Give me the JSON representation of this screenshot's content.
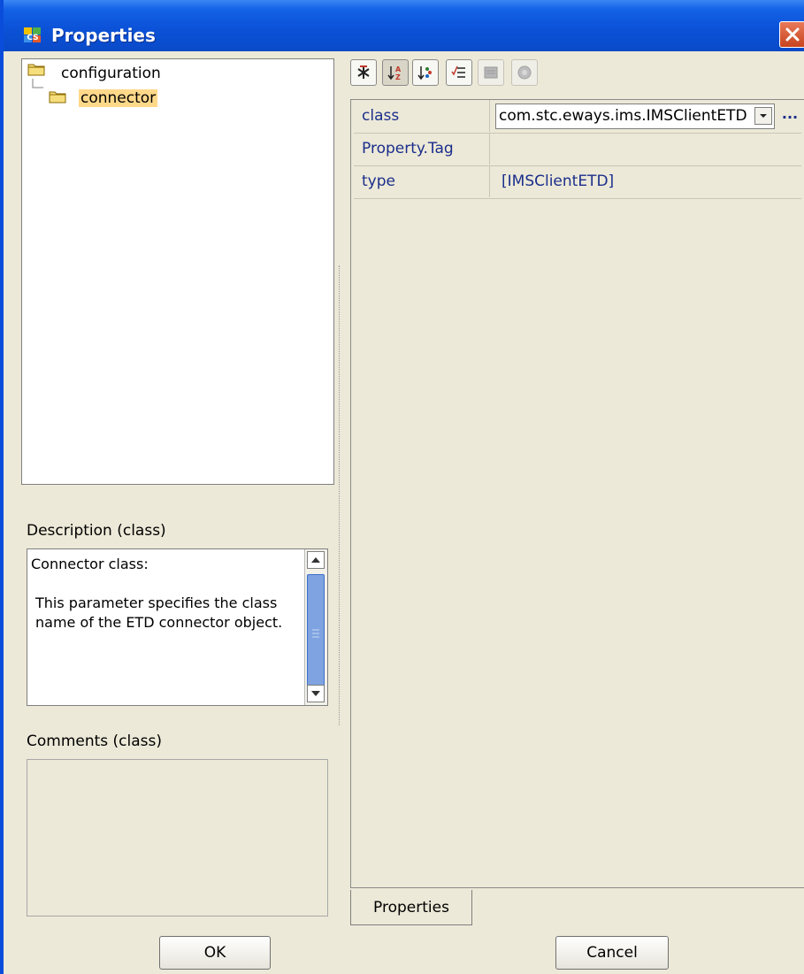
{
  "window": {
    "title": "Properties",
    "icons": {
      "app": "app-icon",
      "close": "close-icon"
    }
  },
  "tree": {
    "root": {
      "label": "configuration",
      "icon": "folder-icon"
    },
    "child": {
      "label": "connector",
      "icon": "folder-icon",
      "selected": true
    }
  },
  "toolbar": {
    "buttons": [
      {
        "name": "expert-mode-icon"
      },
      {
        "name": "sort-alphabetical-icon",
        "active": true
      },
      {
        "name": "sort-by-category-icon"
      },
      {
        "name": "property-list-icon"
      },
      {
        "name": "edit-disabled-icon",
        "disabled": true
      },
      {
        "name": "help-disabled-icon",
        "disabled": true
      }
    ]
  },
  "properties": {
    "rows": [
      {
        "name": "class",
        "value": "com.stc.eways.ims.IMSClientETD",
        "editor": "combo",
        "more": "..."
      },
      {
        "name": "Property.Tag",
        "value": ""
      },
      {
        "name": "type",
        "value": "[IMSClientETD]"
      }
    ]
  },
  "description": {
    "label": "Description (class)",
    "line1": "Connector class:",
    "line2": "This parameter specifies the class name of the ETD connector object."
  },
  "comments": {
    "label": "Comments (class)",
    "text": ""
  },
  "tab": {
    "label": "Properties"
  },
  "buttons": {
    "ok": "OK",
    "cancel": "Cancel"
  },
  "colors": {
    "titlebar": "#0B52D8",
    "face": "#ECE9D8",
    "property_text": "#1B2E8B",
    "selection": "#FFD98A"
  }
}
